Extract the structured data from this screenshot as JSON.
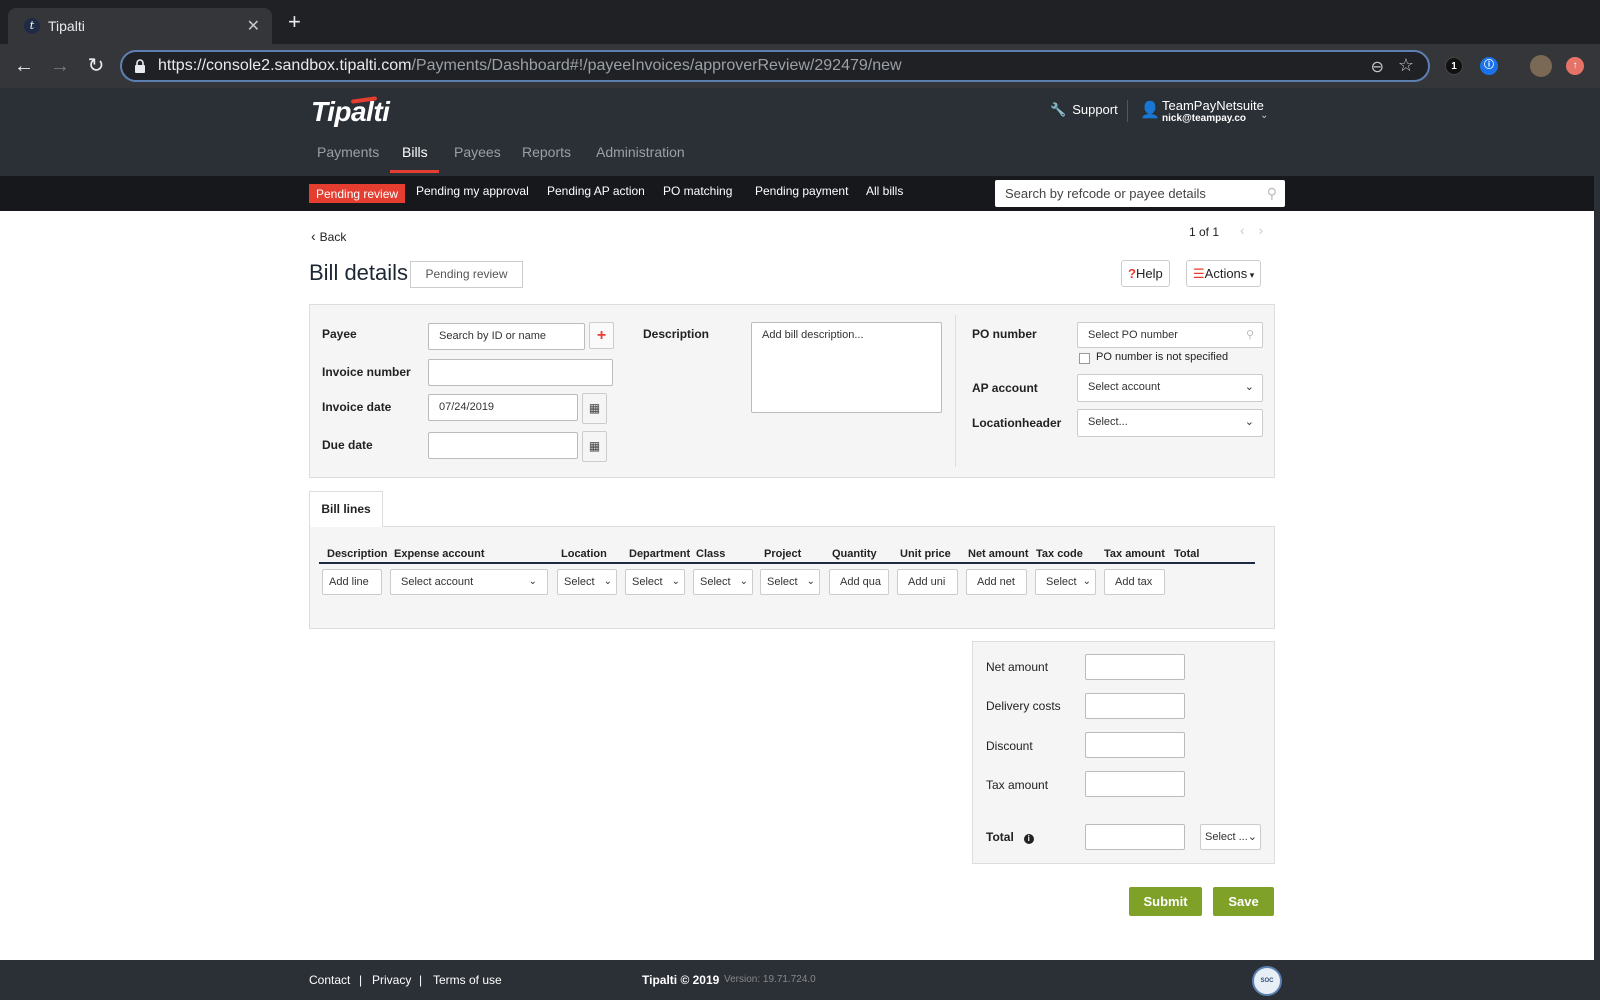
{
  "browser": {
    "tab_title": "Tipalti",
    "url_host": "https://console2.sandbox.tipalti.com",
    "url_path": "/Payments/Dashboard#!/payeeInvoices/approverReview/292479/new",
    "ext1_badge": "1"
  },
  "header": {
    "logo": "Tipalti",
    "support_label": "Support",
    "user_name": "TeamPayNetsuite",
    "user_email": "nick@teampay.co",
    "main_nav": [
      {
        "label": "Payments"
      },
      {
        "label": "Bills"
      },
      {
        "label": "Payees"
      },
      {
        "label": "Reports"
      },
      {
        "label": "Administration"
      }
    ],
    "sub_nav": [
      {
        "label": "Pending review"
      },
      {
        "label": "Pending my approval"
      },
      {
        "label": "Pending AP action"
      },
      {
        "label": "PO matching"
      },
      {
        "label": "Pending payment"
      },
      {
        "label": "All bills"
      }
    ],
    "search_placeholder": "Search by refcode or payee details"
  },
  "page": {
    "back_label": "Back",
    "pager": "1 of 1",
    "title": "Bill details",
    "status": "Pending review",
    "help_label": "Help",
    "actions_label": "Actions"
  },
  "form": {
    "payee_label": "Payee",
    "payee_placeholder": "Search by ID or name",
    "invoice_number_label": "Invoice number",
    "invoice_number_value": "",
    "invoice_date_label": "Invoice date",
    "invoice_date_value": "07/24/2019",
    "due_date_label": "Due date",
    "due_date_value": "",
    "description_label": "Description",
    "description_placeholder": "Add bill description...",
    "po_number_label": "PO number",
    "po_number_placeholder": "Select PO number",
    "po_not_specified_label": "PO number is not specified",
    "ap_account_label": "AP account",
    "ap_account_value": "Select account",
    "location_header_label": "Locationheader",
    "location_header_value": "Select..."
  },
  "bill_lines": {
    "tab_label": "Bill lines",
    "columns": [
      "Description",
      "Expense account",
      "Location",
      "Department",
      "Class",
      "Project",
      "Quantity",
      "Unit price",
      "Net amount",
      "Tax code",
      "Tax amount",
      "Total"
    ],
    "row": {
      "description": "Add line",
      "expense_account": "Select account",
      "location": "Select",
      "department": "Select",
      "class": "Select",
      "project": "Select",
      "quantity": "Add qua",
      "unit_price": "Add uni",
      "net_amount": "Add net",
      "tax_code": "Select",
      "tax_amount": "Add tax"
    }
  },
  "totals": {
    "net_amount_label": "Net amount",
    "delivery_costs_label": "Delivery costs",
    "discount_label": "Discount",
    "tax_amount_label": "Tax amount",
    "total_label": "Total",
    "currency_value": "Select ..."
  },
  "buttons": {
    "submit": "Submit",
    "save": "Save"
  },
  "footer": {
    "contact": "Contact",
    "privacy": "Privacy",
    "terms": "Terms of use",
    "divider": "|",
    "copyright": "Tipalti © 2019",
    "version": "Version: 19.71.724.0",
    "badge": "AICPA SOC"
  },
  "colors": {
    "brand_red": "#e53d2f",
    "header_bg": "#2b2f36",
    "action_green": "#7fa128"
  }
}
